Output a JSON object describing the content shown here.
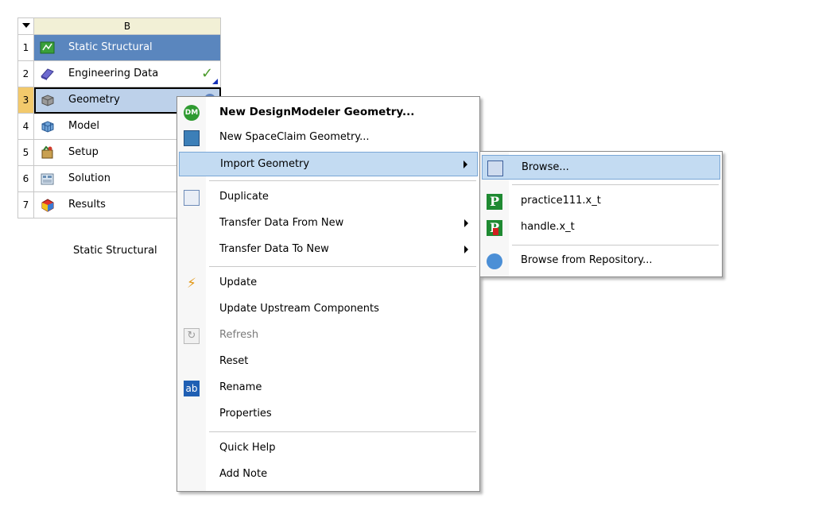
{
  "system": {
    "column_letter": "B",
    "caption": "Static Structural",
    "rows": [
      {
        "num": "1",
        "label": "Static Structural",
        "icon": "static-structural-icon"
      },
      {
        "num": "2",
        "label": "Engineering Data",
        "icon": "engineering-data-icon",
        "status": "✓"
      },
      {
        "num": "3",
        "label": "Geometry",
        "icon": "geometry-icon"
      },
      {
        "num": "4",
        "label": "Model",
        "icon": "model-icon"
      },
      {
        "num": "5",
        "label": "Setup",
        "icon": "setup-icon"
      },
      {
        "num": "6",
        "label": "Solution",
        "icon": "solution-icon"
      },
      {
        "num": "7",
        "label": "Results",
        "icon": "results-icon"
      }
    ]
  },
  "context_menu": {
    "items": [
      {
        "label": "New DesignModeler Geometry...",
        "icon": "designmodeler-icon",
        "icon_text": "DM"
      },
      {
        "label": "New SpaceClaim Geometry...",
        "icon": "spaceclaim-icon"
      },
      {
        "label": "Import Geometry"
      },
      {
        "label": "Duplicate",
        "icon": "duplicate-icon"
      },
      {
        "label": "Transfer Data From New"
      },
      {
        "label": "Transfer Data To New"
      },
      {
        "label": "Update",
        "icon": "update-icon"
      },
      {
        "label": "Update Upstream Components"
      },
      {
        "label": "Refresh",
        "icon": "refresh-icon"
      },
      {
        "label": "Reset"
      },
      {
        "label": "Rename",
        "icon": "rename-icon",
        "icon_text": "ab"
      },
      {
        "label": "Properties"
      },
      {
        "label": "Quick Help"
      },
      {
        "label": "Add Note"
      }
    ]
  },
  "import_submenu": {
    "items": [
      {
        "label": "Browse...",
        "icon": "browse-icon"
      },
      {
        "label": "practice111.x_t",
        "icon": "parasolid-file-icon",
        "icon_text": "P"
      },
      {
        "label": "handle.x_t",
        "icon": "parasolid-file-missing-icon",
        "icon_text": "P"
      },
      {
        "label": "Browse from Repository...",
        "icon": "repository-icon"
      }
    ]
  },
  "colors": {
    "title_row": "#5a86be",
    "selection_highlight": "#c3dbf2",
    "header_fill": "#f2f0d6"
  }
}
